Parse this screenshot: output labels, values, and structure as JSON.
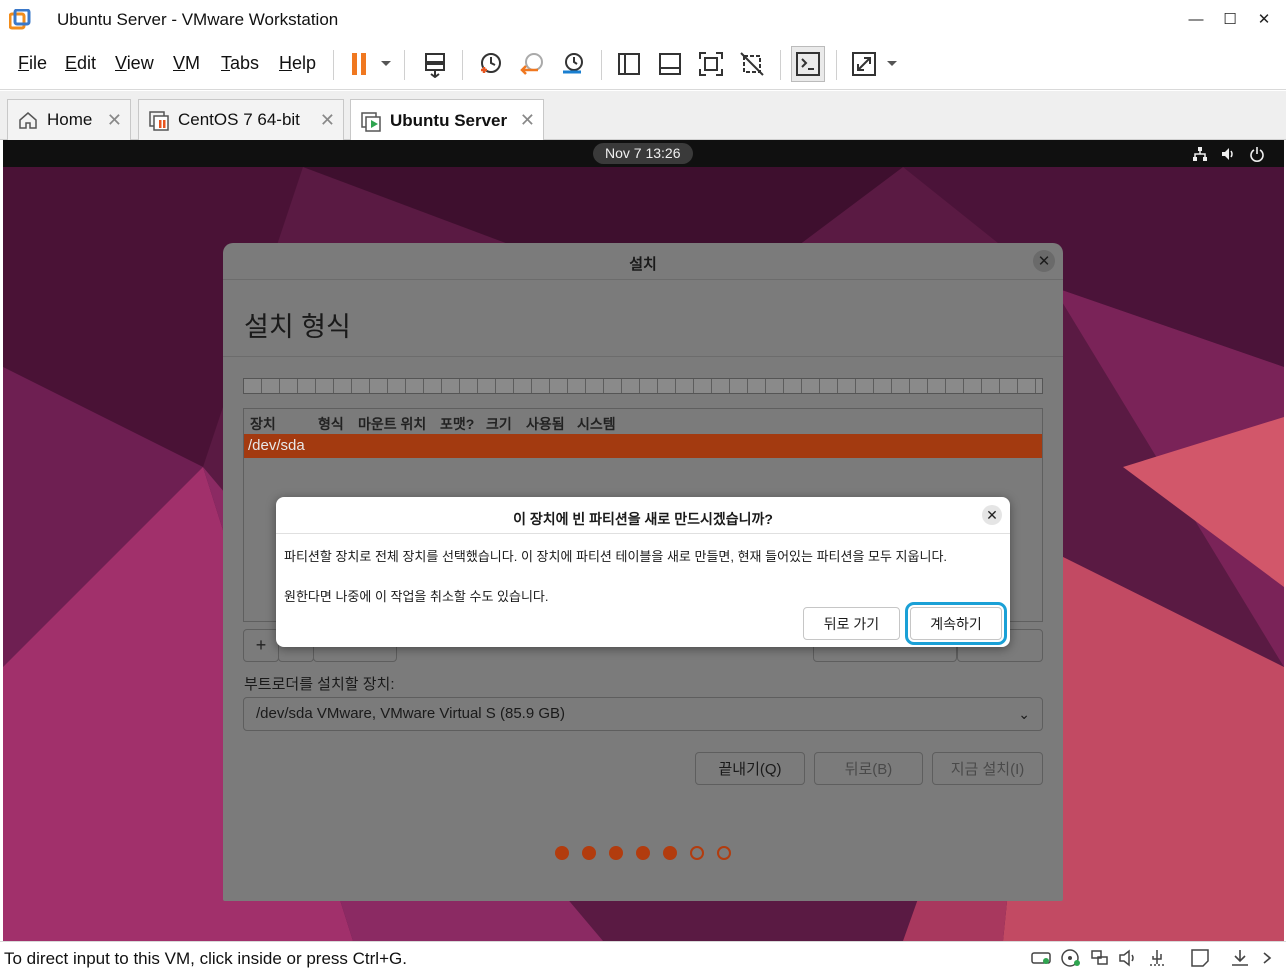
{
  "window": {
    "title": "Ubuntu Server - VMware Workstation",
    "min": "—",
    "max": "☐",
    "close": "✕"
  },
  "menu": [
    {
      "key": "F",
      "rest": "ile"
    },
    {
      "key": "E",
      "rest": "dit"
    },
    {
      "key": "V",
      "rest": "iew"
    },
    {
      "key": "V",
      "rest": "M"
    },
    {
      "key": "T",
      "rest": "abs"
    },
    {
      "key": "H",
      "rest": "elp"
    }
  ],
  "tabs": [
    {
      "label": "Home",
      "icon": "home-icon"
    },
    {
      "label": "CentOS 7 64-bit",
      "icon": "vm-suspended-icon"
    },
    {
      "label": "Ubuntu Server",
      "icon": "vm-running-icon",
      "active": true
    }
  ],
  "guest": {
    "clock": "Nov 7  13:26",
    "installer": {
      "title": "설치",
      "heading": "설치 형식",
      "columns": [
        "장치",
        "형식",
        "마운트 위치",
        "포맷?",
        "크기",
        "사용됨",
        "시스템"
      ],
      "selected_row": "/dev/sda",
      "add": "+",
      "boot_label": "부트로더를 설치할 장치:",
      "boot_device": "/dev/sda VMware, VMware Virtual S (85.9 GB)",
      "buttons": {
        "quit": "끝내기(Q)",
        "back": "뒤로(B)",
        "install": "지금 설치(I)"
      },
      "steps_done": 5,
      "steps_total": 7
    },
    "dialog": {
      "title": "이 장치에 빈 파티션을 새로 만드시겠습니까?",
      "line1": "파티션할 장치로 전체 장치를 선택했습니다. 이 장치에 파티션 테이블을 새로 만들면, 현재 들어있는 파티션을 모두 지웁니다.",
      "line2": "원한다면 나중에 이 작업을 취소할 수도 있습니다.",
      "back": "뒤로 가기",
      "continue": "계속하기"
    }
  },
  "status": {
    "text": "To direct input to this VM, click inside or press Ctrl+G."
  },
  "colors": {
    "accent_orange": "#e95420",
    "selection": "#a33a10",
    "highlight": "#1aa0d6",
    "pause": "#f07820"
  }
}
